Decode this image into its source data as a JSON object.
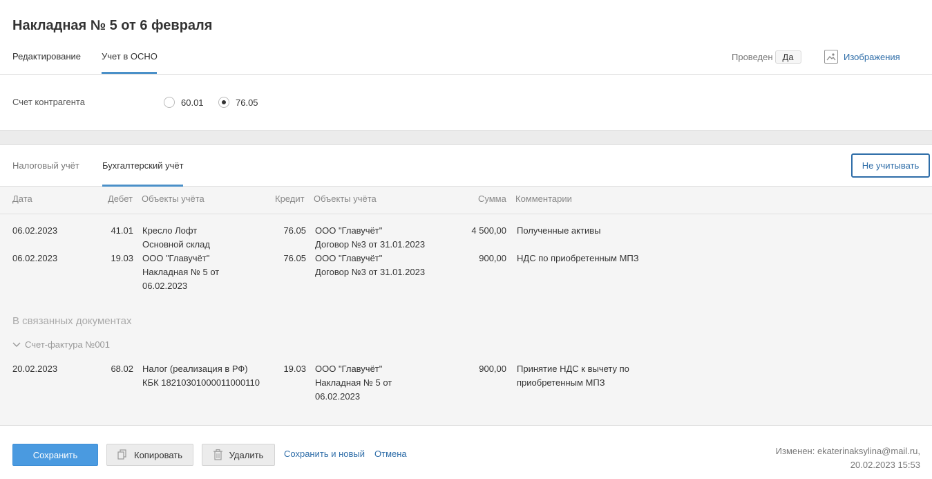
{
  "header": {
    "title": "Накладная № 5 от 6 февраля",
    "tabs": [
      {
        "label": "Редактирование"
      },
      {
        "label": "Учет в ОСНО"
      }
    ],
    "posted_label": "Проведен",
    "posted_value": "Да",
    "images_label": "Изображения"
  },
  "account": {
    "label": "Счет контрагента",
    "options": [
      {
        "label": "60.01",
        "checked": false
      },
      {
        "label": "76.05",
        "checked": true
      }
    ]
  },
  "subtabs": {
    "tabs": [
      {
        "label": "Налоговый учёт"
      },
      {
        "label": "Бухгалтерский учёт"
      }
    ],
    "ignore_button": "Не учитывать"
  },
  "table": {
    "columns": {
      "date": "Дата",
      "debit": "Дебет",
      "debit_objects": "Объекты учёта",
      "credit": "Кредит",
      "credit_objects": "Объекты учёта",
      "sum": "Сумма",
      "comments": "Комментарии"
    },
    "rows": [
      {
        "date": "06.02.2023",
        "debit": "41.01",
        "debit_objects": [
          "Кресло Лофт",
          "Основной склад"
        ],
        "credit": "76.05",
        "credit_objects": [
          "ООО \"Главучёт\"",
          "Договор №3 от 31.01.2023"
        ],
        "sum": "4 500,00",
        "comment": [
          "Полученные активы"
        ]
      },
      {
        "date": "06.02.2023",
        "debit": "19.03",
        "debit_objects": [
          "ООО \"Главучёт\"",
          "Накладная № 5 от",
          "06.02.2023"
        ],
        "credit": "76.05",
        "credit_objects": [
          "ООО \"Главучёт\"",
          "Договор №3 от 31.01.2023"
        ],
        "sum": "900,00",
        "comment": [
          "НДС по приобретенным МПЗ"
        ]
      }
    ],
    "related_title": "В связанных документах",
    "invoice_label": "Счет-фактура №001",
    "related_rows": [
      {
        "date": "20.02.2023",
        "debit": "68.02",
        "debit_objects": [
          "Налог (реализация в РФ)",
          "КБК 18210301000011000110"
        ],
        "credit": "19.03",
        "credit_objects": [
          "ООО \"Главучёт\"",
          "Накладная № 5 от",
          "06.02.2023"
        ],
        "sum": "900,00",
        "comment": [
          "Принятие НДС к вычету по",
          "приобретенным МПЗ"
        ]
      }
    ]
  },
  "footer": {
    "save": "Сохранить",
    "copy": "Копировать",
    "delete": "Удалить",
    "save_new": "Сохранить и новый",
    "cancel": "Отмена",
    "changed_line1": "Изменен: ekaterinaksylina@mail.ru,",
    "changed_line2": "20.02.2023 15:53"
  },
  "colors": {
    "accent": "#4a90c8",
    "link": "#2e6da8",
    "primary_button": "#4a9ae0"
  }
}
